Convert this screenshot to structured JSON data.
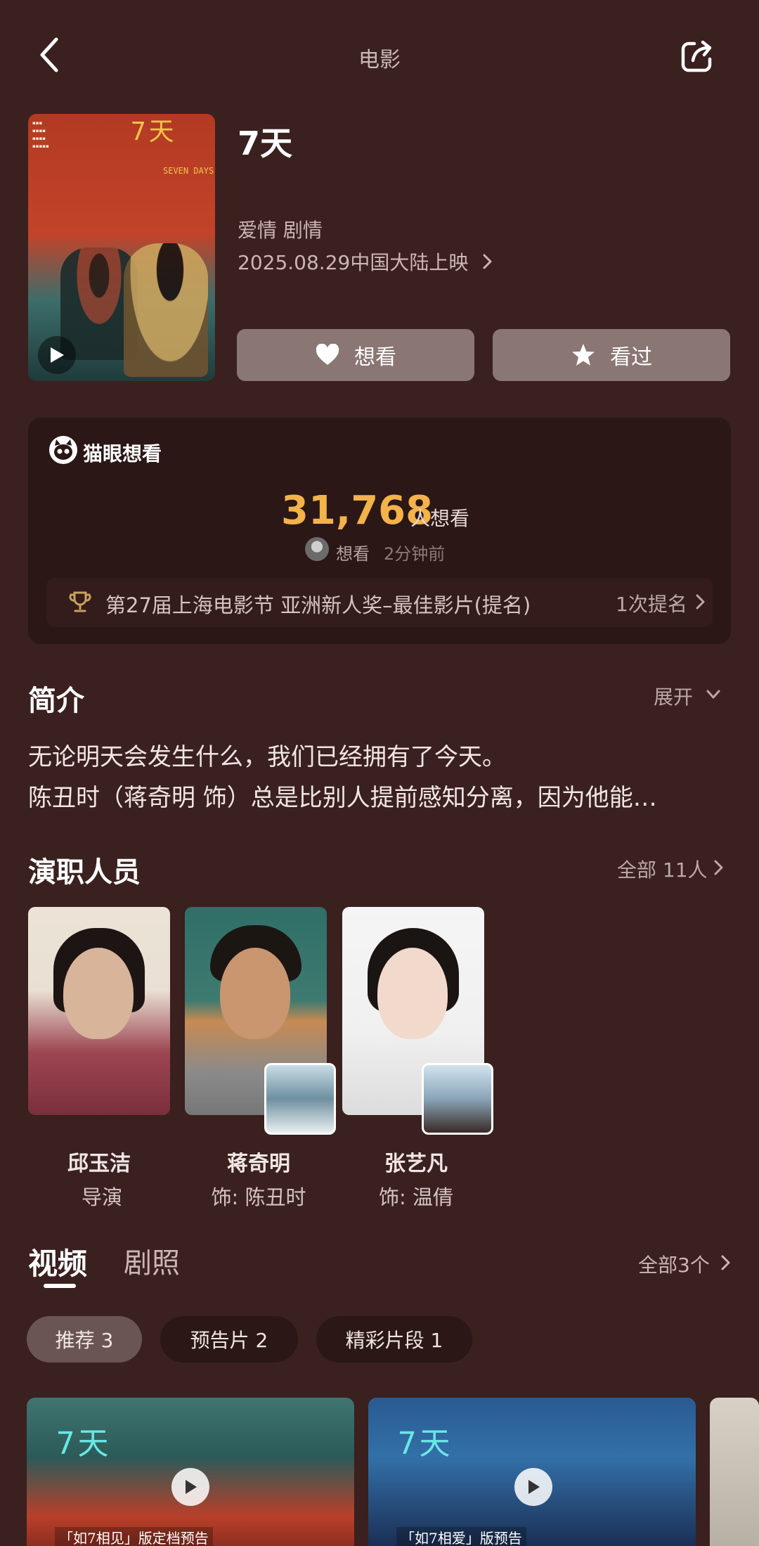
{
  "header": {
    "title": "电影"
  },
  "poster": {
    "logo": "7天",
    "subtitle": "SEVEN DAYS"
  },
  "movie": {
    "title": "7天",
    "genres": "爱情 剧情",
    "release": "2025.08.29中国大陆上映"
  },
  "actions": {
    "want": "想看",
    "seen": "看过"
  },
  "stats": {
    "source": "猫眼想看",
    "count": "31,768",
    "count_unit": "人想看",
    "recent_action": "想看",
    "recent_time": "2分钟前",
    "award": "第27届上海电影节 亚洲新人奖–最佳影片(提名)",
    "award_count": "1次提名"
  },
  "intro": {
    "heading": "简介",
    "expand": "展开",
    "line1": "无论明天会发生什么，我们已经拥有了今天。",
    "line2": "陈丑时（蒋奇明 饰）总是比别人提前感知分离，因为他能…"
  },
  "cast": {
    "heading": "演职人员",
    "all": "全部 11人",
    "members": [
      {
        "name": "邱玉洁",
        "role": "导演"
      },
      {
        "name": "蒋奇明",
        "role": "饰: 陈丑时"
      },
      {
        "name": "张艺凡",
        "role": "饰: 温倩"
      }
    ]
  },
  "media": {
    "tabs": [
      "视频",
      "剧照"
    ],
    "all": "全部3个",
    "chips": [
      "推荐 3",
      "预告片 2",
      "精彩片段 1"
    ],
    "videos": [
      {
        "caption": "「如7相见」版定档预告"
      },
      {
        "caption": "「如7相爱」版预告"
      }
    ]
  },
  "colors": {
    "background": "#3a201f",
    "accent": "#f3b24a",
    "card": "#2a1716"
  }
}
